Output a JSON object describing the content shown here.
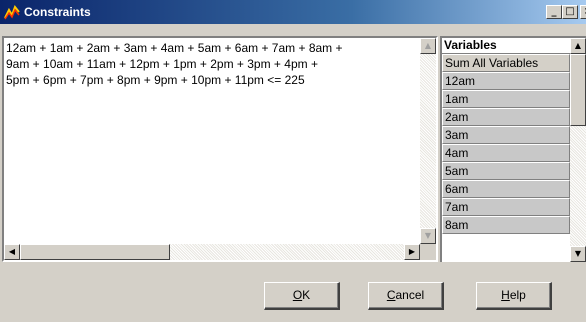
{
  "window": {
    "title": "Constraints",
    "icon": "chart-line-icon",
    "controls": {
      "minimize": "_",
      "maximize": "□",
      "close": "×"
    }
  },
  "constraint_text": {
    "lines": [
      "12am + 1am + 2am + 3am + 4am + 5am + 6am + 7am + 8am +",
      "9am + 10am + 11am + 12pm + 1pm + 2pm + 3pm + 4pm +",
      "5pm + 6pm + 7pm + 8pm + 9pm + 10pm + 11pm <= 225"
    ]
  },
  "variables": {
    "header": "Variables",
    "items": [
      "Sum All Variables",
      "12am",
      "1am",
      "2am",
      "3am",
      "4am",
      "5am",
      "6am",
      "7am",
      "8am"
    ]
  },
  "scroll_glyphs": {
    "up": "▲",
    "down": "▼",
    "left": "◀",
    "right": "▶"
  },
  "buttons": {
    "ok": "OK",
    "cancel": "Cancel",
    "help": "Help"
  }
}
